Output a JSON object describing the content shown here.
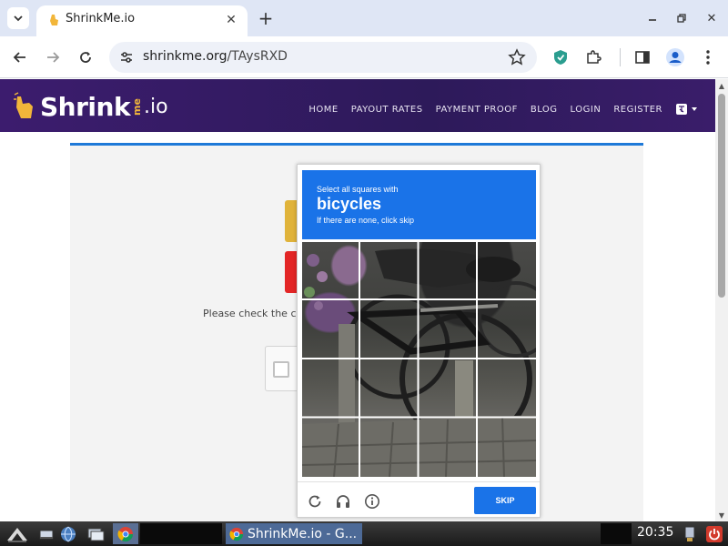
{
  "browser": {
    "tab_title": "ShrinkMe.io",
    "url_host": "shrinkme.org",
    "url_path": "/TAysRXD"
  },
  "site": {
    "logo_main": "Shrink",
    "logo_me": "me",
    "logo_io": ".io",
    "nav": [
      "HOME",
      "PAYOUT RATES",
      "PAYMENT PROOF",
      "BLOG",
      "LOGIN",
      "REGISTER"
    ],
    "please_text": "Please check the ca"
  },
  "captcha": {
    "instruction": "Select all squares with",
    "target": "bicycles",
    "hint": "If there are none, click skip",
    "skip_label": "SKIP",
    "grid_rows": 4,
    "grid_cols": 4
  },
  "taskbar": {
    "window_title": "ShrinkMe.io - G...",
    "clock": "20:35"
  },
  "colors": {
    "header_purple": "#2d1a5a",
    "captcha_blue": "#1a73e8",
    "card_border": "#1e79d8"
  }
}
